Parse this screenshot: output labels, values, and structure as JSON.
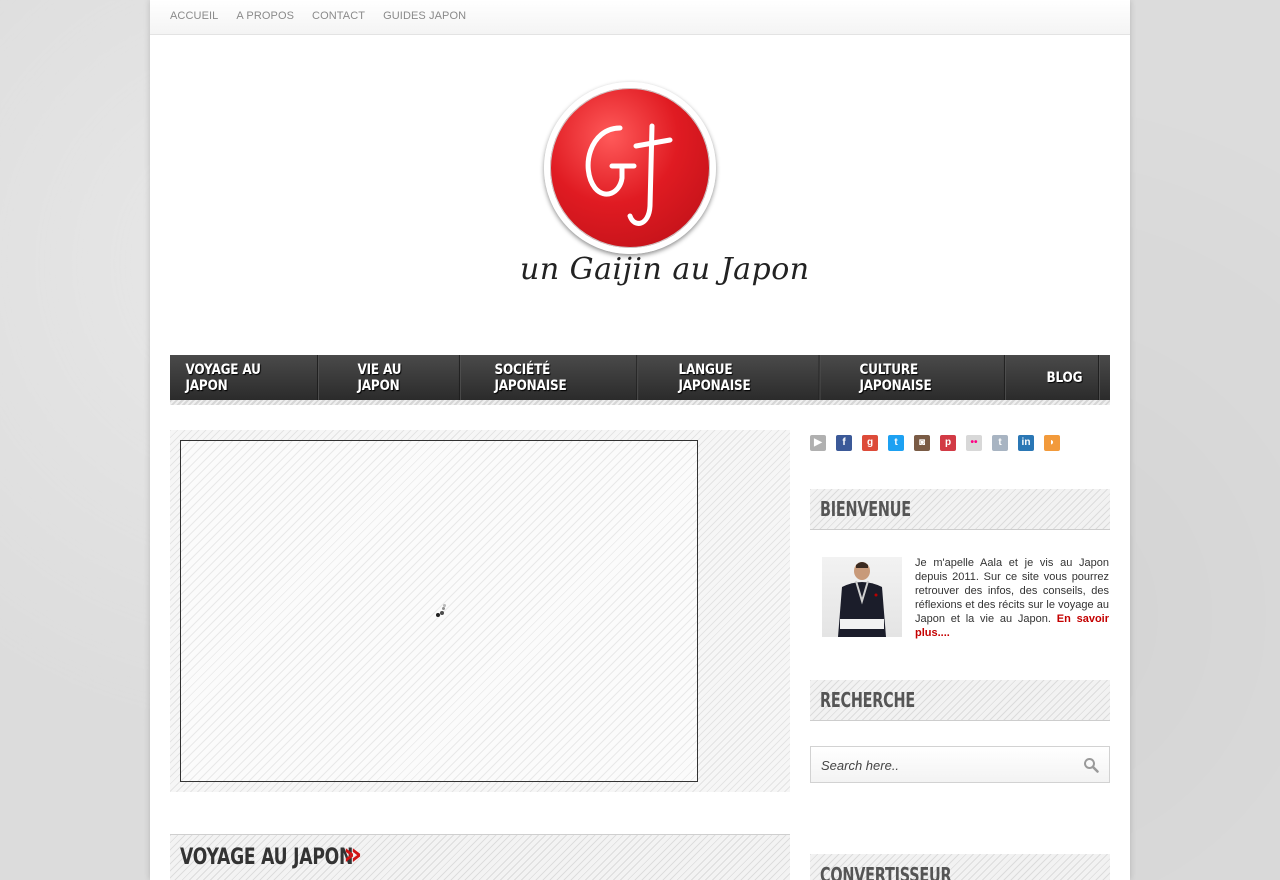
{
  "topnav": {
    "items": [
      "ACCUEIL",
      "A PROPOS",
      "CONTACT",
      "GUIDES JAPON"
    ]
  },
  "logo": {
    "tagline": "un Gaijin au Japon"
  },
  "mainnav": {
    "items": [
      "Voyage au Japon",
      "Vie au Japon",
      "Société Japonaise",
      "Langue Japonaise",
      "Culture Japonaise",
      "Blog"
    ]
  },
  "slider": {
    "loading_icon": "spinner-icon"
  },
  "section": {
    "title": "Voyage au Japon",
    "arrow": "»"
  },
  "social": {
    "icons": [
      "youtube-icon",
      "facebook-icon",
      "google-plus-icon",
      "twitter-icon",
      "instagram-icon",
      "pinterest-icon",
      "flickr-icon",
      "tumblr-icon",
      "linkedin-icon",
      "rss-icon"
    ]
  },
  "sidebar": {
    "welcome_title": "Bienvenue",
    "welcome_text": "Je m'apelle Aala et je vis au Japon depuis 2011. Sur ce site vous pourrez retrouver des infos, des conseils, des réflexions et des récits sur le voyage au Japon et la vie au Japon.",
    "welcome_more": "En savoir plus....",
    "search_title": "Recherche",
    "search_placeholder": "Search here..",
    "converter_title": "Convertisseur"
  },
  "colors": {
    "accent": "#d01414",
    "nav_bg": "#333333"
  }
}
